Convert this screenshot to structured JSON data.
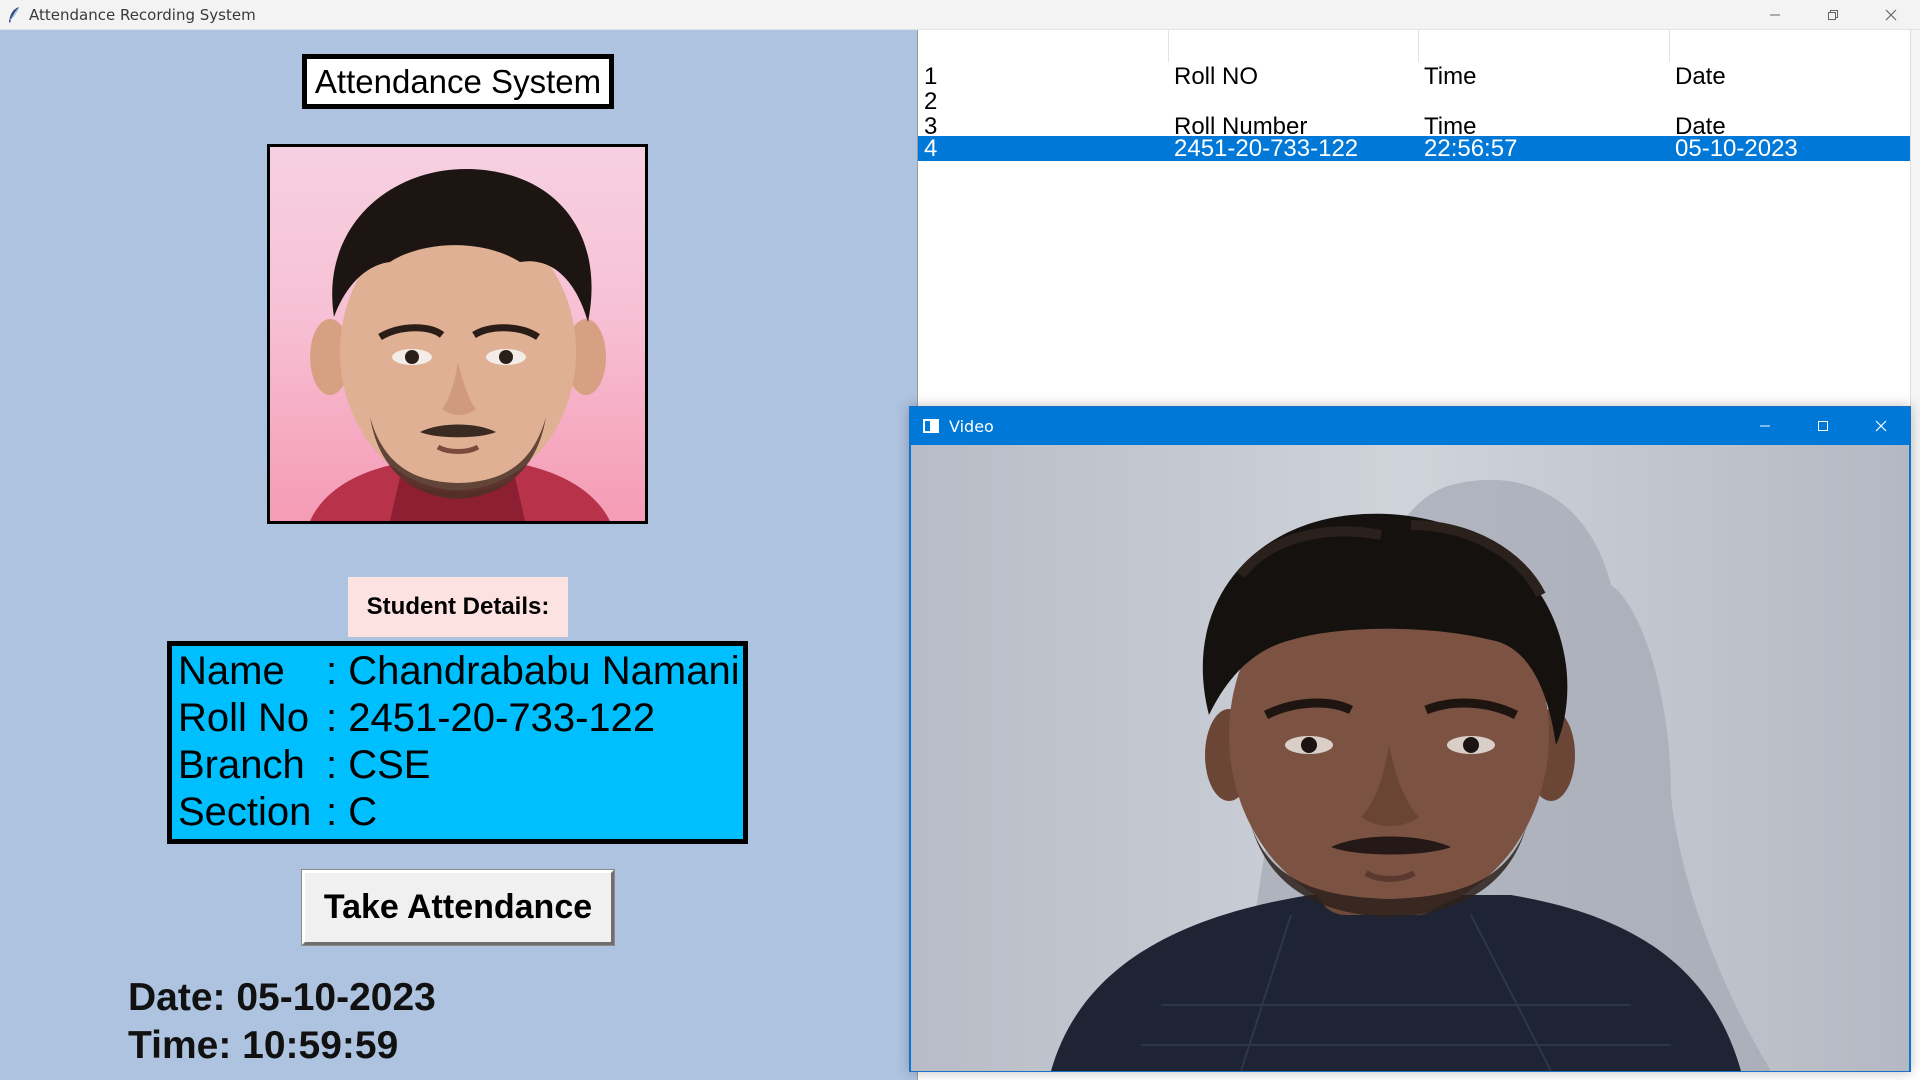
{
  "window": {
    "title": "Attendance Recording System",
    "icon": "feather-icon",
    "controls": [
      "minimize-icon",
      "restore-icon",
      "close-icon"
    ]
  },
  "app": {
    "heading": "Attendance System",
    "photo": "student-photo"
  },
  "student": {
    "section_label": "Student Details:",
    "fields": [
      {
        "key": "Name",
        "value": ": Chandrababu Namani"
      },
      {
        "key": "Roll No",
        "value": ": 2451-20-733-122"
      },
      {
        "key": "Branch",
        "value": ": CSE"
      },
      {
        "key": "Section",
        "value": ": C"
      }
    ]
  },
  "actions": {
    "take_attendance": "Take Attendance"
  },
  "clock": {
    "date": "Date: 05-10-2023",
    "time": "Time: 10:59:59"
  },
  "table": {
    "rows": [
      [
        "1",
        "Roll NO",
        "Time",
        "Date"
      ],
      [
        "2",
        "",
        "",
        ""
      ],
      [
        "3",
        "Roll Number",
        "Time",
        "Date"
      ],
      [
        "4",
        "2451-20-733-122",
        "22:56:57",
        "05-10-2023"
      ]
    ],
    "selected_row": 4
  },
  "video_window": {
    "title": "Video",
    "controls": [
      "minimize-icon",
      "maximize-icon",
      "close-icon"
    ]
  },
  "colors": {
    "background": "#aec3e0",
    "details_box": "#00bfff",
    "details_label_bg": "#fde2e2",
    "selection": "#0078d7",
    "video_titlebar": "#0078d7"
  }
}
